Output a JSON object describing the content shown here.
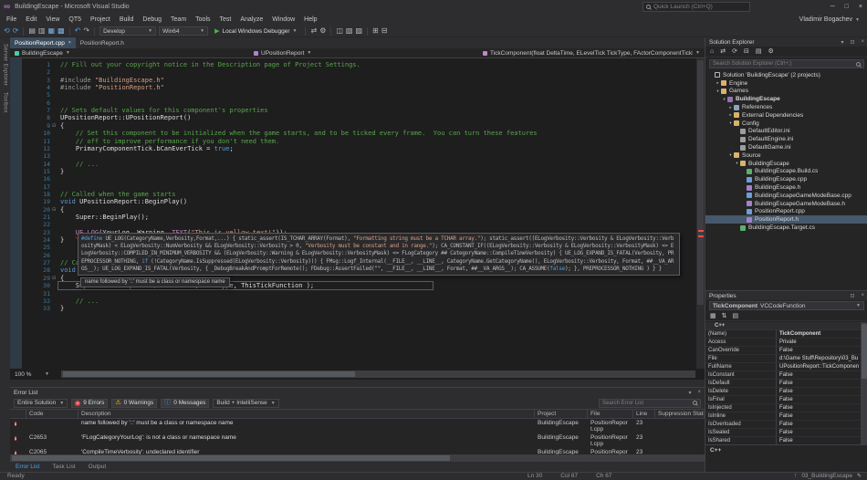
{
  "window": {
    "title": "BuildingEscape - Microsoft Visual Studio",
    "quick_launch_placeholder": "Quick Launch (Ctrl+Q)",
    "user_name": "Vladimir Bogachev"
  },
  "window_controls": [
    {
      "name": "minimize-button",
      "glyph": "─"
    },
    {
      "name": "maximize-button",
      "glyph": "□"
    },
    {
      "name": "close-button",
      "glyph": "×"
    }
  ],
  "panel_chrome": {
    "menu": "▾",
    "pin": "⊡",
    "close": "×"
  },
  "menu": [
    "File",
    "Edit",
    "View",
    "QT5",
    "Project",
    "Build",
    "Debug",
    "Team",
    "Tools",
    "Test",
    "Analyze",
    "Window",
    "Help"
  ],
  "toolbar": {
    "solution_config": "Develop",
    "solution_platform": "Win64",
    "run_button": "Local Windows Debugger",
    "play_icon": "▶",
    "icons_left": [
      {
        "name": "navigate-backward-icon",
        "glyph": "⟲",
        "color": "#4f9fe0"
      },
      {
        "name": "navigate-forward-icon",
        "glyph": "⟳",
        "color": "#4f9fe0"
      },
      {
        "name": "separator"
      },
      {
        "name": "new-project-icon",
        "glyph": "▤"
      },
      {
        "name": "open-file-icon",
        "glyph": "▥"
      },
      {
        "name": "save-icon",
        "glyph": "▦",
        "color": "#7ab0dd"
      },
      {
        "name": "save-all-icon",
        "glyph": "▩",
        "color": "#7ab0dd"
      },
      {
        "name": "separator"
      },
      {
        "name": "undo-icon",
        "glyph": "↶",
        "color": "#4f9fe0"
      },
      {
        "name": "redo-icon",
        "glyph": "↷"
      },
      {
        "name": "separator"
      }
    ],
    "icons_right": [
      {
        "name": "separator"
      },
      {
        "name": "attach-to-process-icon",
        "glyph": "⇄"
      },
      {
        "name": "build-settings-icon",
        "glyph": "⚙"
      },
      {
        "name": "separator"
      },
      {
        "name": "find-in-files-icon",
        "glyph": "◫"
      },
      {
        "name": "comment-icon",
        "glyph": "▧"
      },
      {
        "name": "uncomment-icon",
        "glyph": "▨"
      },
      {
        "name": "separator"
      },
      {
        "name": "bookmark-icon",
        "glyph": "⊞"
      },
      {
        "name": "collapse-icon",
        "glyph": "⊟"
      }
    ]
  },
  "side_strip": [
    "Server Explorer",
    "Toolbox"
  ],
  "editor": {
    "tabs": [
      {
        "label": "PositionReport.cpp",
        "active": true
      },
      {
        "label": "PositionReport.h",
        "active": false
      }
    ],
    "breadcrumb": {
      "project": "BuildingEscape",
      "type": "UPositionReport",
      "member": "TickComponent(float DeltaTime, ELevelTick TickType, FActorComponentTickFunction * Th"
    },
    "zoom": "100 %",
    "error_tooltip": "name followed by '::' must be a class or namespace name",
    "code_lines": [
      {
        "n": 1,
        "t": [
          [
            "c",
            "// Fill out your copyright notice in the Description page of Project Settings."
          ]
        ]
      },
      {
        "n": 2,
        "t": []
      },
      {
        "n": 3,
        "t": [
          [
            "p",
            "#include "
          ],
          [
            "s",
            "\"BuildingEscape.h\""
          ]
        ]
      },
      {
        "n": 4,
        "t": [
          [
            "p",
            "#include "
          ],
          [
            "s",
            "\"PositionReport.h\""
          ]
        ]
      },
      {
        "n": 5,
        "t": []
      },
      {
        "n": 6,
        "t": []
      },
      {
        "n": 7,
        "t": [
          [
            "c",
            "// Sets default values for this component's properties"
          ]
        ]
      },
      {
        "n": 8,
        "t": [
          [
            "i",
            "UPositionReport::UPositionReport()"
          ]
        ]
      },
      {
        "n": 9,
        "fold": true,
        "t": [
          [
            "i",
            "{"
          ]
        ]
      },
      {
        "n": 10,
        "t": [
          [
            "c",
            "    // Set this component to be initialized when the game starts, and to be ticked every frame.  You can turn these features"
          ]
        ]
      },
      {
        "n": 11,
        "t": [
          [
            "c",
            "    // off to improve performance if you don't need them."
          ]
        ]
      },
      {
        "n": 12,
        "t": [
          [
            "i",
            "    PrimaryComponentTick.bCanEverTick = "
          ],
          [
            "k",
            "true"
          ],
          [
            "i",
            ";"
          ]
        ]
      },
      {
        "n": 13,
        "t": []
      },
      {
        "n": 14,
        "t": [
          [
            "c",
            "    // ..."
          ]
        ]
      },
      {
        "n": 15,
        "t": [
          [
            "i",
            "}"
          ]
        ]
      },
      {
        "n": 16,
        "t": []
      },
      {
        "n": 17,
        "t": []
      },
      {
        "n": 18,
        "t": [
          [
            "c",
            "// Called when the game starts"
          ]
        ]
      },
      {
        "n": 19,
        "t": [
          [
            "k",
            "void"
          ],
          [
            "i",
            " UPositionReport::BeginPlay()"
          ]
        ]
      },
      {
        "n": 20,
        "fold": true,
        "t": [
          [
            "i",
            "{"
          ]
        ]
      },
      {
        "n": 21,
        "t": [
          [
            "i",
            "    Super::BeginPlay();"
          ]
        ]
      },
      {
        "n": 22,
        "t": []
      },
      {
        "n": 23,
        "t": [
          [
            "i",
            "    "
          ],
          [
            "m",
            "UE_LOG",
            "sq"
          ],
          [
            "i",
            "("
          ],
          [
            "i",
            "YourLog",
            "sq"
          ],
          [
            "i",
            ", Warning, "
          ],
          [
            "m",
            "TEXT"
          ],
          [
            "i",
            "("
          ],
          [
            "s",
            "\"This is yellow text!\""
          ],
          [
            "i",
            "));"
          ]
        ]
      },
      {
        "n": 24,
        "t": [
          [
            "i",
            "}"
          ]
        ]
      },
      {
        "n": 25,
        "t": []
      },
      {
        "n": 26,
        "t": []
      },
      {
        "n": 27,
        "t": [
          [
            "c",
            "// Called every frame"
          ]
        ]
      },
      {
        "n": 28,
        "t": [
          [
            "k",
            "void"
          ],
          [
            "i",
            " UPositionReport::TickComponent( "
          ],
          [
            "k",
            "float"
          ],
          [
            "i",
            " DeltaTime, ELevelTick TickType, FActorComponentTickFunction* ThisTickFunction )"
          ]
        ]
      },
      {
        "n": 29,
        "fold": true,
        "t": [
          [
            "i",
            "{"
          ]
        ]
      },
      {
        "n": 30,
        "caret": true,
        "t": [
          [
            "i",
            "    Super::TickComponent( DeltaTime, TickType, ThisTickFunction );"
          ]
        ]
      },
      {
        "n": 31,
        "t": []
      },
      {
        "n": 32,
        "t": [
          [
            "c",
            "    // ..."
          ]
        ]
      },
      {
        "n": 33,
        "t": [
          [
            "i",
            "}"
          ]
        ]
      }
    ],
    "macro_popup": {
      "tokens": [
        [
          "k",
          "#define"
        ],
        [
          "i",
          " UE_LOG(CategoryName,Verbosity,Format,...) { static_assert(IS_TCHAR_ARRAY(Format), "
        ],
        [
          "s",
          "\"Formatting string must be a TCHAR array.\""
        ],
        [
          "i",
          "); static_assert((ELogVerbosity::Verbosity & ELogVerbosity::VerbosityMask) < ELogVerbosity::NumVerbosity && ELogVerbosity::Verbosity > 0, "
        ],
        [
          "s",
          "\"Verbosity must be constant and in range.\""
        ],
        [
          "i",
          "); CA_CONSTANT_IF((ELogVerbosity::Verbosity & ELogVerbosity::VerbosityMask) <= ELogVerbosity::COMPILED_IN_MINIMUM_VERBOSITY && (ELogVerbosity::Warning & ELogVerbosity::VerbosityMask) <= FLogCategory ## CategoryName::CompileTimeVerbosity) { UE_LOG_EXPAND_IS_FATAL(Verbosity, PREPROCESSOR_NOTHING, "
        ],
        [
          "k",
          "if"
        ],
        [
          "i",
          " (!CategoryName.IsSuppressed(ELogVerbosity::Verbosity))) { FMsg::Logf_Internal(__FILE__, __LINE__, CategoryName.GetCategoryName(), ELogVerbosity::Verbosity, Format, ##__VA_ARGS__); UE_LOG_EXPAND_IS_FATAL(Verbosity, { _DebugBreakAndPromptForRemote(); FDebug::AssertFailed(\"\", __FILE__, __LINE__, Format, ##__VA_ARGS__); CA_ASSUME("
        ],
        [
          "k",
          "false"
        ],
        [
          "i",
          "); }, PREPROCESSOR_NOTHING ) } }"
        ]
      ]
    }
  },
  "solution_explorer": {
    "title": "Solution Explorer",
    "search_placeholder": "Search Solution Explorer (Ctrl+;)",
    "toolbar_icons": [
      {
        "name": "home-icon",
        "glyph": "⌂"
      },
      {
        "name": "switch-views-icon",
        "glyph": "⇄"
      },
      {
        "name": "refresh-icon",
        "glyph": "⟳"
      },
      {
        "name": "collapse-all-icon",
        "glyph": "⊟"
      },
      {
        "name": "show-all-files-icon",
        "glyph": "▤"
      },
      {
        "name": "properties-icon",
        "glyph": "⚙"
      }
    ],
    "tree": [
      {
        "label": "Solution 'BuildingEscape' (2 projects)",
        "depth": 0,
        "icon": "solution",
        "expander": "none"
      },
      {
        "label": "Engine",
        "depth": 1,
        "icon": "folder",
        "expander": "closed"
      },
      {
        "label": "Games",
        "depth": 1,
        "icon": "folder",
        "expander": "open"
      },
      {
        "label": "BuildingEscape",
        "depth": 2,
        "icon": "project",
        "expander": "open",
        "bold": true
      },
      {
        "label": "References",
        "depth": 3,
        "icon": "refs",
        "expander": "closed"
      },
      {
        "label": "External Dependencies",
        "depth": 3,
        "icon": "folder",
        "expander": "closed"
      },
      {
        "label": "Config",
        "depth": 3,
        "icon": "folder",
        "expander": "open"
      },
      {
        "label": "DefaultEditor.ini",
        "depth": 4,
        "icon": "ini",
        "expander": "none"
      },
      {
        "label": "DefaultEngine.ini",
        "depth": 4,
        "icon": "ini",
        "expander": "none"
      },
      {
        "label": "DefaultGame.ini",
        "depth": 4,
        "icon": "ini",
        "expander": "none"
      },
      {
        "label": "Source",
        "depth": 3,
        "icon": "folder",
        "expander": "open"
      },
      {
        "label": "BuildingEscape",
        "depth": 4,
        "icon": "folder",
        "expander": "open"
      },
      {
        "label": "BuildingEscape.Build.cs",
        "depth": 5,
        "icon": "cs",
        "expander": "none"
      },
      {
        "label": "BuildingEscape.cpp",
        "depth": 5,
        "icon": "cpp",
        "expander": "none"
      },
      {
        "label": "BuildingEscape.h",
        "depth": 5,
        "icon": "h",
        "expander": "none"
      },
      {
        "label": "BuildingEscapeGameModeBase.cpp",
        "depth": 5,
        "icon": "cpp",
        "expander": "none"
      },
      {
        "label": "BuildingEscapeGameModeBase.h",
        "depth": 5,
        "icon": "h",
        "expander": "none"
      },
      {
        "label": "PositionReport.cpp",
        "depth": 5,
        "icon": "cpp",
        "expander": "none"
      },
      {
        "label": "PositionReport.h",
        "depth": 5,
        "icon": "h",
        "expander": "none",
        "selected": true
      },
      {
        "label": "BuildingEscape.Target.cs",
        "depth": 4,
        "icon": "cs",
        "expander": "none"
      }
    ]
  },
  "properties": {
    "title": "Properties",
    "object_name": "TickComponent",
    "object_type": "VCCodeFunction",
    "toolbar_icons": [
      {
        "name": "categorized-icon",
        "glyph": "▦"
      },
      {
        "name": "alphabetical-icon",
        "glyph": "⇅"
      },
      {
        "name": "property-pages-icon",
        "glyph": "▤"
      }
    ],
    "category": "C++",
    "rows": [
      [
        "(Name)",
        "TickComponent"
      ],
      [
        "Access",
        "Private"
      ],
      [
        "CanOverride",
        "False"
      ],
      [
        "File",
        "d:\\Game Stuff\\Repository\\03_Bu"
      ],
      [
        "FullName",
        "UPositionReport::TickComponen"
      ],
      [
        "IsConstant",
        "False"
      ],
      [
        "IsDefault",
        "False"
      ],
      [
        "IsDelete",
        "False"
      ],
      [
        "IsFinal",
        "False"
      ],
      [
        "IsInjected",
        "False"
      ],
      [
        "IsInline",
        "False"
      ],
      [
        "IsOverloaded",
        "False"
      ],
      [
        "IsSealed",
        "False"
      ],
      [
        "IsShared",
        "False"
      ]
    ],
    "footer_category": "C++"
  },
  "error_list": {
    "title": "Error List",
    "scope_combo": "Entire Solution",
    "errors_label": "9 Errors",
    "warnings_label": "0 Warnings",
    "messages_label": "0 Messages",
    "source_combo": "Build + IntelliSense",
    "search_placeholder": "Search Error List",
    "columns": [
      "",
      "Code",
      "Description",
      "Project",
      "File",
      "Line",
      "Suppression State"
    ],
    "rows": [
      {
        "code": "",
        "description": "name followed by '::' must be a class or namespace name",
        "project": "BuildingEscape",
        "file": "PositionReport.cpp",
        "line": "23",
        "suppression": ""
      },
      {
        "code": "C2653",
        "description": "'FLogCategoryYourLog': is not a class or namespace name",
        "project": "BuildingEscape",
        "file": "PositionReport.cpp",
        "line": "23",
        "suppression": ""
      },
      {
        "code": "C2065",
        "description": "'CompileTimeVerbosity': undeclared identifier",
        "project": "BuildingEscape",
        "file": "PositionReport.cpp",
        "line": "23",
        "suppression": ""
      }
    ]
  },
  "panel_tabs": [
    "Error List",
    "Task List",
    "Output"
  ],
  "status_bar": {
    "ready": "Ready",
    "ln": "Ln 30",
    "col": "Col 67",
    "ch": "Ch 67",
    "repo": "03_BuildingEscape"
  }
}
